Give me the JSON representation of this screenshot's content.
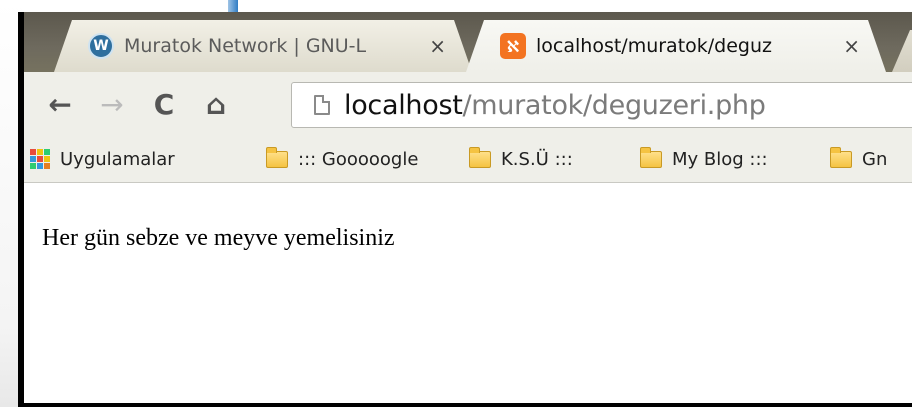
{
  "tabs": [
    {
      "title": "Muratok Network | GNU-L",
      "close": "×",
      "icon": "wordpress-icon",
      "active": false
    },
    {
      "title": "localhost/muratok/deguz",
      "close": "×",
      "icon": "xampp-icon",
      "active": true
    }
  ],
  "toolbar": {
    "back_icon": "←",
    "forward_icon": "→",
    "reload_icon": "C",
    "home_icon": "⌂",
    "url_host": "localhost",
    "url_path": "/muratok/deguzeri.php"
  },
  "bookmarks": [
    {
      "label": "Uygulamalar",
      "icon": "apps-icon"
    },
    {
      "label": "::: Gooooogle",
      "icon": "folder-icon"
    },
    {
      "label": "K.S.Ü :::",
      "icon": "folder-icon"
    },
    {
      "label": "My Blog :::",
      "icon": "folder-icon"
    },
    {
      "label": "Gn",
      "icon": "folder-icon"
    }
  ],
  "page": {
    "text": "Her gün sebze ve meyve yemelisiniz"
  },
  "colors": {
    "tabstrip": "#6e6a5e",
    "toolbar": "#efefe9",
    "xampp_orange": "#f37321",
    "wordpress_blue": "#2f6f9e"
  }
}
